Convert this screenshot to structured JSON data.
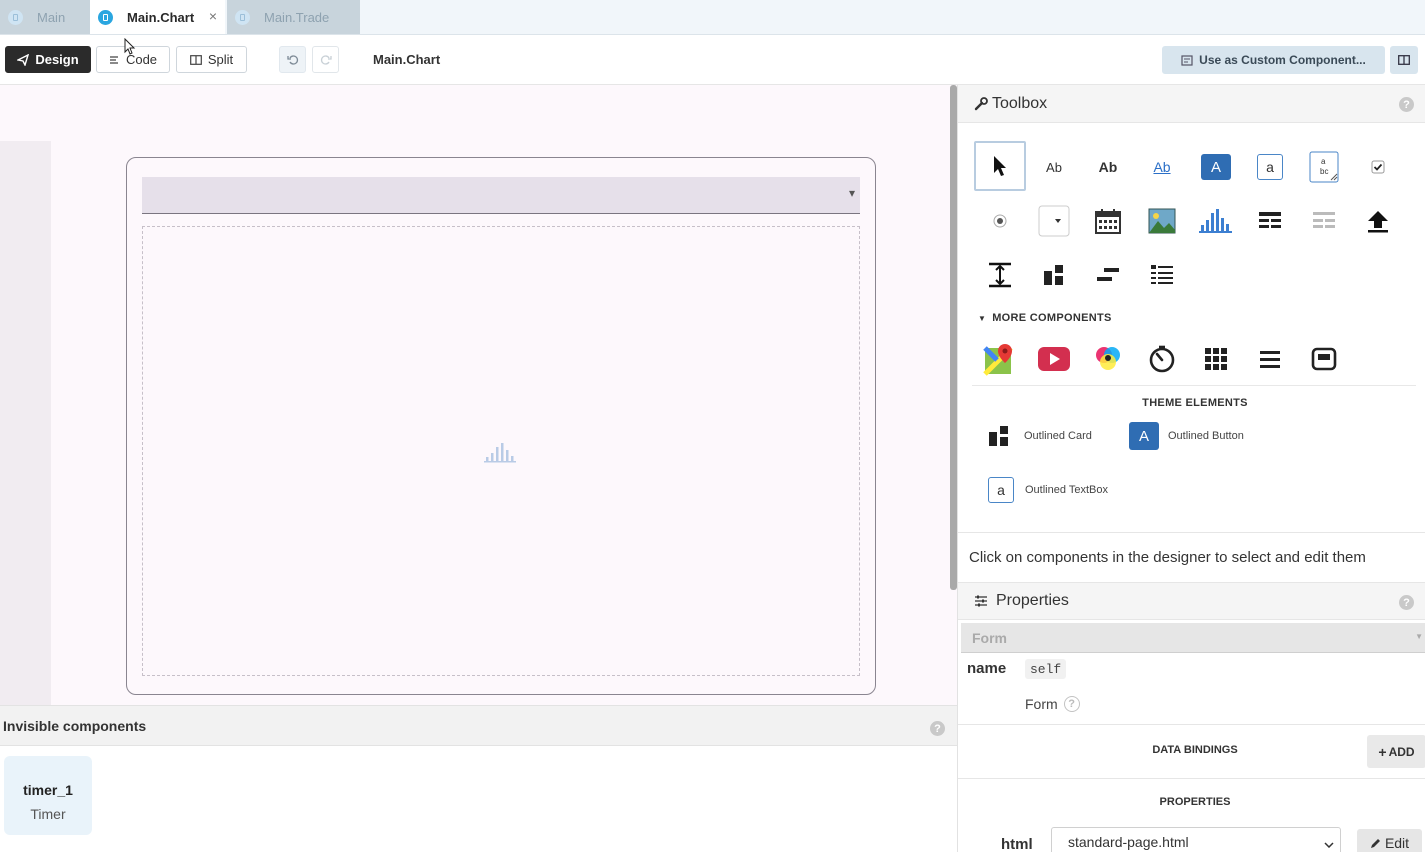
{
  "tabs": [
    {
      "label": "Main"
    },
    {
      "label": "Main.Chart",
      "close": "×"
    },
    {
      "label": "Main.Trade"
    }
  ],
  "toolbar": {
    "design": "Design",
    "code": "Code",
    "split": "Split",
    "title": "Main.Chart",
    "custom": "Use as Custom Component..."
  },
  "designer": {
    "dropdown_arrow": "▾"
  },
  "invisible": {
    "header": "Invisible components",
    "help": "?",
    "component": {
      "name": "timer_1",
      "type": "Timer"
    }
  },
  "toolbox": {
    "title": "Toolbox",
    "help": "?",
    "row1_labels": [
      "Ab",
      "Ab",
      "Ab",
      "A",
      "a"
    ],
    "more_label": "MORE COMPONENTS",
    "theme_label": "THEME ELEMENTS",
    "theme_items": [
      {
        "label": "Outlined Card"
      },
      {
        "label": "Outlined Button",
        "icon": "A"
      },
      {
        "label": "Outlined TextBox",
        "icon": "a"
      }
    ],
    "hint": "Click on components in the designer to select and edit them"
  },
  "properties": {
    "title": "Properties",
    "help": "?",
    "form_label": "Form",
    "name_key": "name",
    "name_value": "self",
    "form_link": "Form",
    "data_bindings": "DATA BINDINGS",
    "add": "ADD",
    "props_label": "PROPERTIES",
    "html_key": "html",
    "html_value": "standard-page.html",
    "edit": "Edit"
  },
  "colors": {
    "accent": "#2b8fd6",
    "chart_blue": "#3c7fd1",
    "button_blue": "#2f6db3"
  }
}
